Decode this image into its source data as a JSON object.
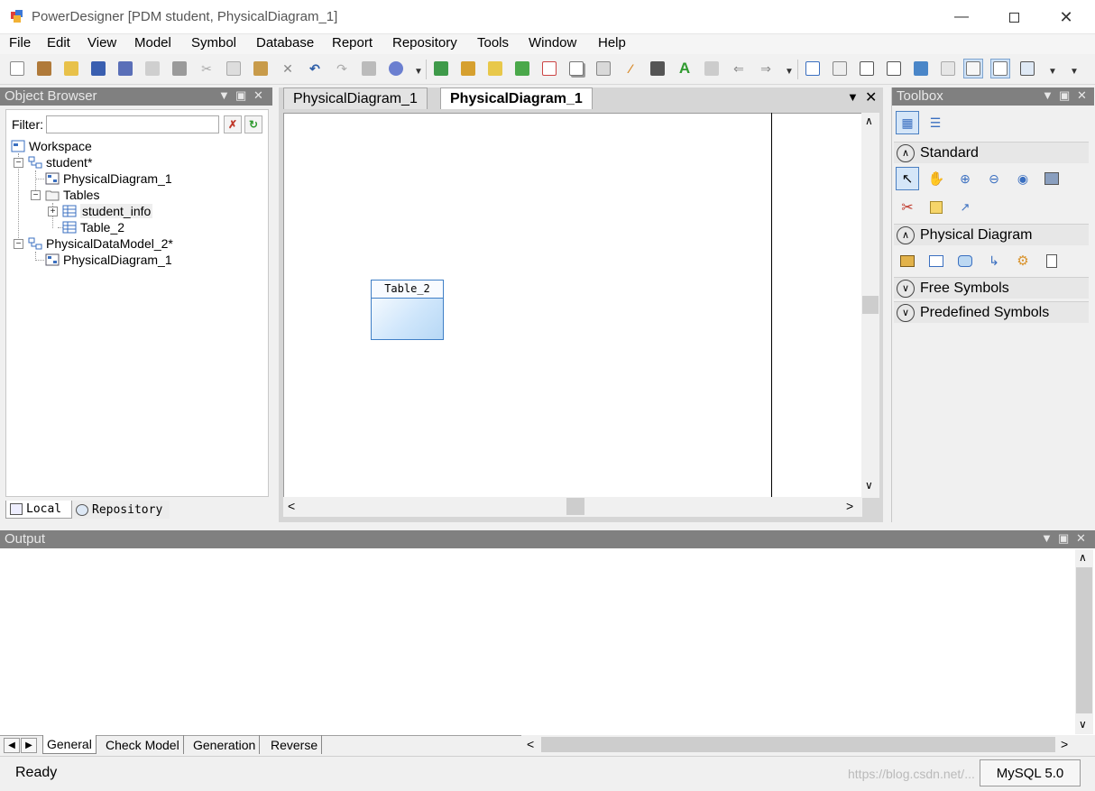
{
  "window": {
    "title": "PowerDesigner [PDM student, PhysicalDiagram_1]",
    "minimize_icon": "minimize-icon",
    "maximize_icon": "maximize-icon",
    "close_icon": "close-icon"
  },
  "menu": [
    "File",
    "Edit",
    "View",
    "Model",
    "Symbol",
    "Database",
    "Report",
    "Repository",
    "Tools",
    "Window",
    "Help"
  ],
  "object_browser": {
    "title": "Object Browser",
    "filter_label": "Filter:",
    "filter_value": "",
    "tree": {
      "workspace": "Workspace",
      "student": "student",
      "student_mod": "*",
      "diagram1": "PhysicalDiagram_1",
      "tables": "Tables",
      "student_info": "student_info",
      "table2": "Table_2",
      "pdm2": "PhysicalDataModel_2",
      "pdm2_mod": "*",
      "diagram2": "PhysicalDiagram_1"
    },
    "tabs": {
      "local": "Local",
      "repository": "Repository"
    }
  },
  "diagram": {
    "tabs": [
      "PhysicalDiagram_1",
      "PhysicalDiagram_1"
    ],
    "active_tab": 1,
    "table_symbol": "Table_2"
  },
  "toolbox": {
    "title": "Toolbox",
    "sections": {
      "standard": "Standard",
      "physical": "Physical Diagram",
      "free": "Free Symbols",
      "predefined": "Predefined Symbols"
    }
  },
  "output": {
    "title": "Output",
    "tabs": [
      "General",
      "Check Model",
      "Generation",
      "Reverse"
    ],
    "active_tab": 0
  },
  "status": {
    "text": "Ready",
    "dbms": "MySQL 5.0",
    "watermark": "https://blog.csdn.net/..."
  },
  "colors": {
    "panel_header": "#808080",
    "selection_blue": "#cfe2f7",
    "table_border": "#3f7fc6"
  }
}
